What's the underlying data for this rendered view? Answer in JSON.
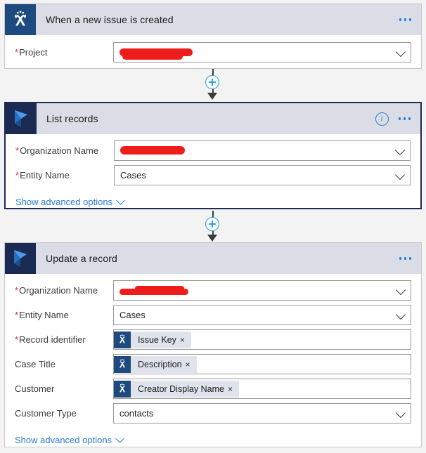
{
  "app": {
    "name": "Power Automate flow designer",
    "accent_blue": "#2b7cd3",
    "plus_blue": "#2b9fe8",
    "required_red": "#d13438",
    "jira_icon_bg": "#1e4b7f",
    "d365_icon_bg": "#1b2a52",
    "header_bg": "#dadde5",
    "selected_border": "#1f2a54",
    "redaction_color": "#ef1c1c"
  },
  "cards": [
    {
      "id": "trigger",
      "title": "When a new issue is created",
      "icon": "jira-icon",
      "selected": false,
      "has_info": false,
      "menu_label": "...",
      "fields": [
        {
          "label": "Project",
          "required": true,
          "type": "dropdown",
          "value": "",
          "redacted": true
        }
      ],
      "advanced": null
    },
    {
      "id": "list-records",
      "title": "List records",
      "icon": "dynamics365-icon",
      "selected": true,
      "has_info": true,
      "info_label": "i",
      "menu_label": "...",
      "fields": [
        {
          "label": "Organization Name",
          "required": true,
          "type": "dropdown",
          "value": "",
          "redacted": true
        },
        {
          "label": "Entity Name",
          "required": true,
          "type": "dropdown",
          "value": "Cases",
          "redacted": false
        }
      ],
      "advanced": "Show advanced options"
    },
    {
      "id": "update-record",
      "title": "Update a record",
      "icon": "dynamics365-icon",
      "selected": false,
      "has_info": false,
      "menu_label": "...",
      "fields": [
        {
          "label": "Organization Name",
          "required": true,
          "type": "dropdown",
          "value": "",
          "redacted": true
        },
        {
          "label": "Entity Name",
          "required": true,
          "type": "dropdown",
          "value": "Cases",
          "redacted": false
        },
        {
          "label": "Record identifier",
          "required": true,
          "type": "token",
          "token": {
            "text": "Issue Key",
            "icon": "jira-icon",
            "remove": "×"
          }
        },
        {
          "label": "Case Title",
          "required": false,
          "type": "token",
          "token": {
            "text": "Description",
            "icon": "jira-icon",
            "remove": "×"
          }
        },
        {
          "label": "Customer",
          "required": false,
          "type": "token",
          "token": {
            "text": "Creator Display Name",
            "icon": "jira-icon",
            "remove": "×"
          }
        },
        {
          "label": "Customer Type",
          "required": false,
          "type": "dropdown",
          "value": "contacts",
          "redacted": false
        }
      ],
      "advanced": "Show advanced options"
    }
  ],
  "connectors": [
    {
      "id": "connector-1",
      "action": "insert-step"
    },
    {
      "id": "connector-2",
      "action": "insert-step"
    }
  ]
}
